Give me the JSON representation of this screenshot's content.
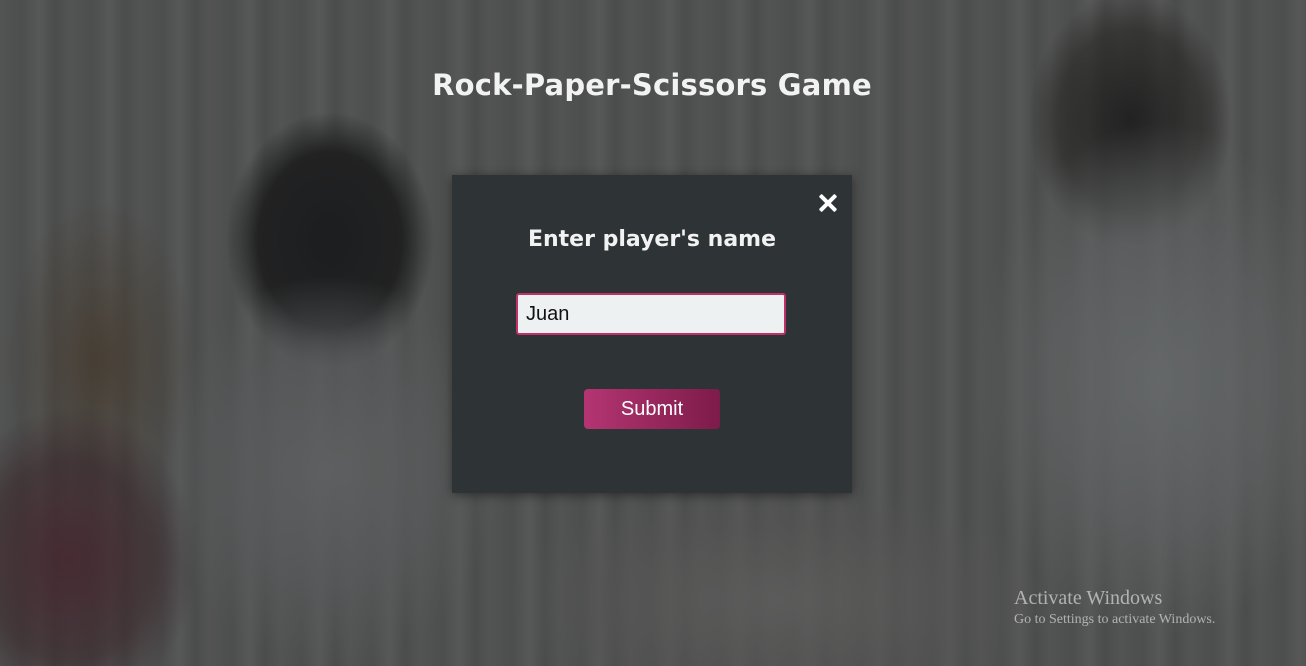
{
  "page": {
    "title": "Rock-Paper-Scissors Game"
  },
  "modal": {
    "title": "Enter player's name",
    "close_icon": "close-icon",
    "name_input": {
      "value": "Juan",
      "placeholder": ""
    },
    "submit_label": "Submit"
  },
  "watermark": {
    "line1": "Activate Windows",
    "line2": "Go to Settings to activate Windows."
  },
  "colors": {
    "modal_background": "#2e3436",
    "input_border": "#c0306a",
    "button_gradient_start": "#b43572",
    "button_gradient_end": "#7d1b4a"
  }
}
